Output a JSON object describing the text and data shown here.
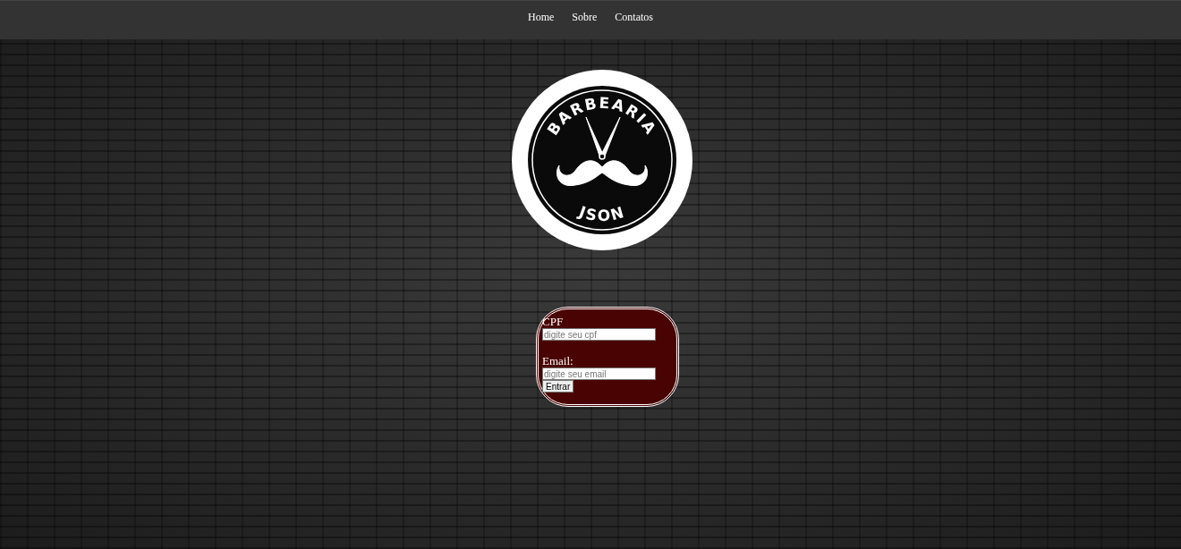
{
  "nav": {
    "links": [
      "Home",
      "Sobre",
      "Contatos"
    ]
  },
  "logo": {
    "top_text": "BARBEARIA",
    "bottom_text": "JSON"
  },
  "login_form": {
    "fields": [
      {
        "label": "CPF",
        "placeholder": "digite seu cpf"
      },
      {
        "label": "Email:",
        "placeholder": "digite seu email"
      }
    ],
    "submit": "Entrar"
  }
}
